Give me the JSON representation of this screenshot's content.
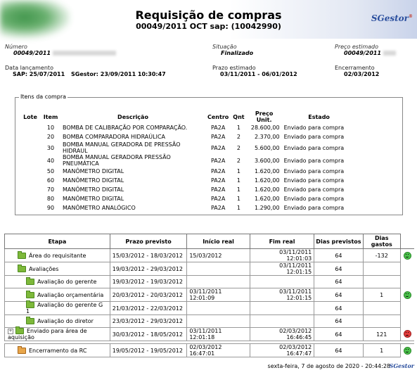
{
  "header": {
    "title": "Requisição de compras",
    "subtitle": "00049/2011 OCT sap: (10042990)",
    "logo": "SGestor",
    "logo_sup": "®"
  },
  "info": {
    "numero_label": "Número",
    "numero_value": "00049/2011",
    "situacao_label": "Situação",
    "situacao_value": "Finalizado",
    "preco_label": "Preço estimado",
    "preco_value": "00049/2011",
    "data_label": "Data lançamento",
    "data_sap": "SAP: 25/07/2011",
    "data_sgestor": "SGestor: 23/09/2011 10:30:47",
    "prazo_label": "Prazo estimado",
    "prazo_value": "03/11/2011 - 06/01/2012",
    "encerramento_label": "Encerramento",
    "encerramento_value": "02/03/2012"
  },
  "items": {
    "legend": "Itens da compra",
    "headers": [
      "Lote",
      "Item",
      "Descrição",
      "Centro",
      "Qnt",
      "Preço Unit.",
      "Estado"
    ],
    "rows": [
      {
        "lote": "",
        "item": "10",
        "desc": "BOMBA DE CALIBRAÇÃO POR COMPARAÇÃO.",
        "centro": "PA2A",
        "qnt": "1",
        "preco": "28.600,00",
        "estado": "Enviado para compra"
      },
      {
        "lote": "",
        "item": "20",
        "desc": "BOMBA COMPARADORA HIDRAÚLICA",
        "centro": "PA2A",
        "qnt": "2",
        "preco": "2.370,00",
        "estado": "Enviado para compra"
      },
      {
        "lote": "",
        "item": "30",
        "desc": "BOMBA MANUAL GERADORA DE PRESSÃO HIDRAUL",
        "centro": "PA2A",
        "qnt": "2",
        "preco": "5.600,00",
        "estado": "Enviado para compra"
      },
      {
        "lote": "",
        "item": "40",
        "desc": "BOMBA MANUAL GERADORA PRESSÃO PNEUMÁTICA",
        "centro": "PA2A",
        "qnt": "2",
        "preco": "3.600,00",
        "estado": "Enviado para compra"
      },
      {
        "lote": "",
        "item": "50",
        "desc": "MANÔMETRO DIGITAL",
        "centro": "PA2A",
        "qnt": "1",
        "preco": "1.620,00",
        "estado": "Enviado para compra"
      },
      {
        "lote": "",
        "item": "60",
        "desc": "MANÔMETRO DIGITAL",
        "centro": "PA2A",
        "qnt": "1",
        "preco": "1.620,00",
        "estado": "Enviado para compra"
      },
      {
        "lote": "",
        "item": "70",
        "desc": "MANÔMETRO DIGITAL",
        "centro": "PA2A",
        "qnt": "1",
        "preco": "1.620,00",
        "estado": "Enviado para compra"
      },
      {
        "lote": "",
        "item": "80",
        "desc": "MANÔMETRO DIGITAL",
        "centro": "PA2A",
        "qnt": "1",
        "preco": "1.620,00",
        "estado": "Enviado para compra"
      },
      {
        "lote": "",
        "item": "90",
        "desc": "MANÔMETRO ANALÓGICO",
        "centro": "PA2A",
        "qnt": "1",
        "preco": "1.290,00",
        "estado": "Enviado para compra"
      }
    ]
  },
  "stages": {
    "headers": [
      "Etapa",
      "Prazo previsto",
      "Início real",
      "Fim real",
      "Dias previstos",
      "Dias gastos"
    ],
    "rows": [
      {
        "etapa": "Área do requisitante",
        "prazo": "15/03/2012 - 18/03/2012",
        "inicio": "15/03/2012",
        "fim": "03/11/2011 12:01:03",
        "dias_prev": "64",
        "dias_gastos": "-132",
        "status": "ok"
      },
      {
        "etapa": "Avaliações",
        "prazo": "19/03/2012 - 29/03/2012",
        "inicio": "",
        "fim": "03/11/2011 12:01:15",
        "dias_prev": "64",
        "dias_gastos": "",
        "status": ""
      },
      {
        "etapa": "Avaliação do gerente",
        "prazo": "19/03/2012 - 19/03/2012",
        "inicio": "",
        "fim": "",
        "dias_prev": "64",
        "dias_gastos": "",
        "status": ""
      },
      {
        "etapa": "Avaliação orçamentária",
        "prazo": "20/03/2012 - 20/03/2012",
        "inicio": "03/11/2011 12:01:09",
        "fim": "03/11/2011 12:01:15",
        "dias_prev": "64",
        "dias_gastos": "1",
        "status": "ok"
      },
      {
        "etapa": "Avaliação do gerente G 1",
        "prazo": "21/03/2012 - 22/03/2012",
        "inicio": "",
        "fim": "",
        "dias_prev": "64",
        "dias_gastos": "",
        "status": ""
      },
      {
        "etapa": "Avaliação do diretor",
        "prazo": "23/03/2012 - 29/03/2012",
        "inicio": "",
        "fim": "",
        "dias_prev": "64",
        "dias_gastos": "",
        "status": ""
      },
      {
        "etapa": "Enviado para área de aquisição",
        "prazo": "30/03/2012 - 18/05/2012",
        "inicio": "03/11/2011 12:01:18",
        "fim": "02/03/2012 16:46:45",
        "dias_prev": "64",
        "dias_gastos": "121",
        "status": "bad"
      },
      {
        "etapa": "Encerramento da RC",
        "prazo": "19/05/2012 - 19/05/2012",
        "inicio": "02/03/2012 16:47:01",
        "fim": "02/03/2012 16:47:47",
        "dias_prev": "64",
        "dias_gastos": "1",
        "status": "ok"
      }
    ]
  },
  "footer": {
    "date": "sexta-feira, 7 de agosto de 2020 - 20:44:28",
    "logo": "SGestor"
  }
}
